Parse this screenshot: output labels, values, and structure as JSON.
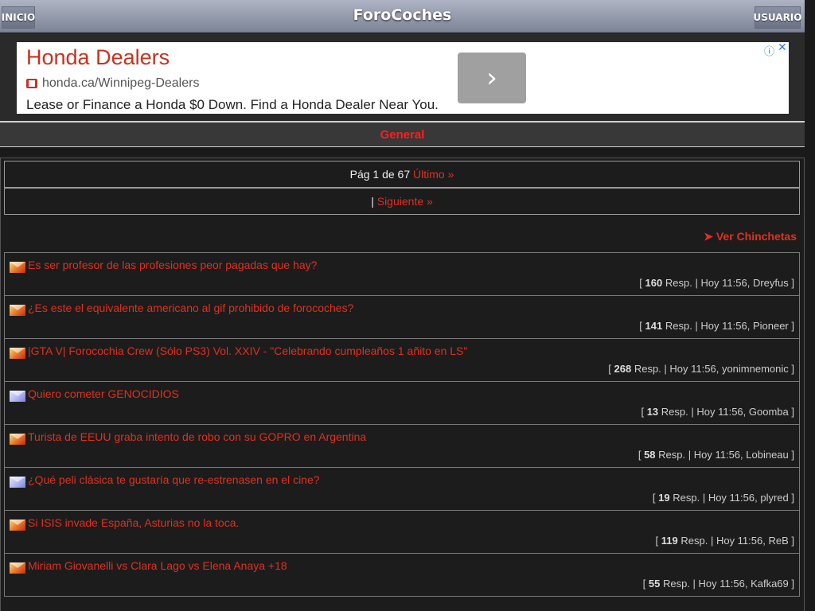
{
  "topbar": {
    "left_button": "INICIO",
    "title": "ForoCoches",
    "right_button": "USUARIO"
  },
  "ad": {
    "title": "Honda Dealers",
    "url": "honda.ca/Winnipeg-Dealers",
    "description": "Lease or Finance a Honda $0 Down. Find a Honda Dealer Near You.",
    "go_glyph": "›",
    "info_glyph": "ⓘ",
    "close_glyph": "✕"
  },
  "section": {
    "title": "General"
  },
  "pagination": {
    "page_text": "Pág 1 de 67",
    "last_link": "Último »",
    "separator": "|",
    "next_link": "Siguiente »"
  },
  "chinchetas_link": "➤ Ver Chinchetas",
  "threads": [
    {
      "title": "Es ser profesor de las profesiones peor pagadas que hay?",
      "replies": "160",
      "time": "Hoy 11:56",
      "user": "Dreyfus",
      "icon": "hot"
    },
    {
      "title": "¿Es este el equivalente americano al gif prohibido de forocoches?",
      "replies": "141",
      "time": "Hoy 11:56",
      "user": "Pioneer",
      "icon": "hot"
    },
    {
      "title": "|GTA V| Forocochia Crew (Sólo PS3) Vol. XXIV - \"Celebrando cumpleaños 1 añito en LS\"",
      "replies": "268",
      "time": "Hoy 11:56",
      "user": "yonimnemonic",
      "icon": "hot"
    },
    {
      "title": "Quiero cometer GENOCIDIOS",
      "replies": "13",
      "time": "Hoy 11:56",
      "user": "Goomba",
      "icon": "cool"
    },
    {
      "title": "Turista de EEUU graba intento de robo con su GOPRO en Argentina",
      "replies": "58",
      "time": "Hoy 11:56",
      "user": "Lobineau",
      "icon": "hot"
    },
    {
      "title": "¿Qué peli clásica te gustaría que re-estrenasen en el cine?",
      "replies": "19",
      "time": "Hoy 11:56",
      "user": "plyred",
      "icon": "cool"
    },
    {
      "title": "Si ISIS invade España, Asturias no la toca.",
      "replies": "119",
      "time": "Hoy 11:56",
      "user": "ReB",
      "icon": "hot"
    },
    {
      "title": "Miriam Giovanelli vs Clara Lago vs Elena Anaya +18",
      "replies": "55",
      "time": "Hoy 11:56",
      "user": "Kafka69",
      "icon": "hot"
    }
  ],
  "labels": {
    "resp": "Resp."
  }
}
